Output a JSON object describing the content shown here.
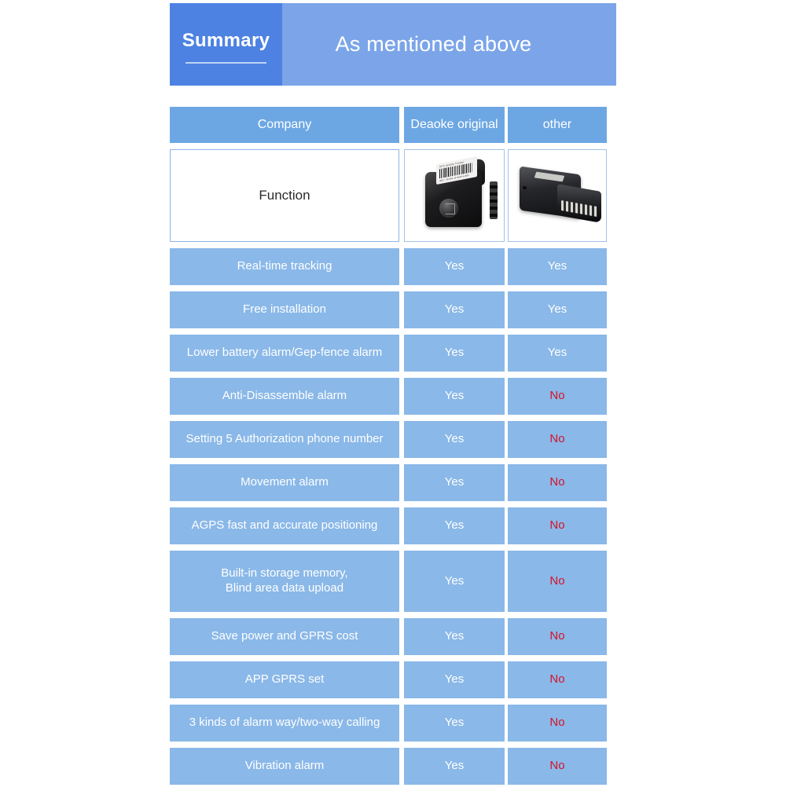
{
  "banner": {
    "tab_label": "Summary",
    "headline": "As mentioned above"
  },
  "table": {
    "columns": [
      "Company",
      "Deaoke original",
      "other"
    ],
    "function_row": {
      "label": "Function",
      "product_a_alt": "deaoke-obd-gps-tracker-photo",
      "product_b_alt": "other-obd-device-photo"
    },
    "rows": [
      {
        "feature": "Real-time tracking",
        "a": "Yes",
        "b": "Yes",
        "b_state": "yes"
      },
      {
        "feature": "Free installation",
        "a": "Yes",
        "b": "Yes",
        "b_state": "yes"
      },
      {
        "feature": "Lower battery alarm/Gep-fence alarm",
        "a": "Yes",
        "b": "Yes",
        "b_state": "yes"
      },
      {
        "feature": "Anti-Disassemble alarm",
        "a": "Yes",
        "b": "No",
        "b_state": "no"
      },
      {
        "feature": "Setting 5 Authorization phone number",
        "a": "Yes",
        "b": "No",
        "b_state": "no"
      },
      {
        "feature": "Movement alarm",
        "a": "Yes",
        "b": "No",
        "b_state": "no"
      },
      {
        "feature": "AGPS fast and accurate positioning",
        "a": "Yes",
        "b": "No",
        "b_state": "no"
      },
      {
        "feature": "Built-in storage memory,\nBlind area data upload",
        "a": "Yes",
        "b": "No",
        "b_state": "no",
        "tall": true
      },
      {
        "feature": "Save power and GPRS cost",
        "a": "Yes",
        "b": "No",
        "b_state": "no"
      },
      {
        "feature": "APP GPRS set",
        "a": "Yes",
        "b": "No",
        "b_state": "no"
      },
      {
        "feature": "3 kinds of alarm way/two-way calling",
        "a": "Yes",
        "b": "No",
        "b_state": "no"
      },
      {
        "feature": "Vibration alarm",
        "a": "Yes",
        "b": "No",
        "b_state": "no"
      }
    ]
  },
  "device_a_label": {
    "title": "GPS Vehicle Tracker",
    "code": "IMEI : 352384 1678646 41880"
  },
  "colors": {
    "banner_tab": "#4d82e2",
    "banner_main": "#7ba5e8",
    "header_cell": "#6da7e3",
    "data_cell": "#8ab8e8",
    "no_red": "#d5122a",
    "yes_white": "#ffffff",
    "page_background": "#ffffff"
  }
}
